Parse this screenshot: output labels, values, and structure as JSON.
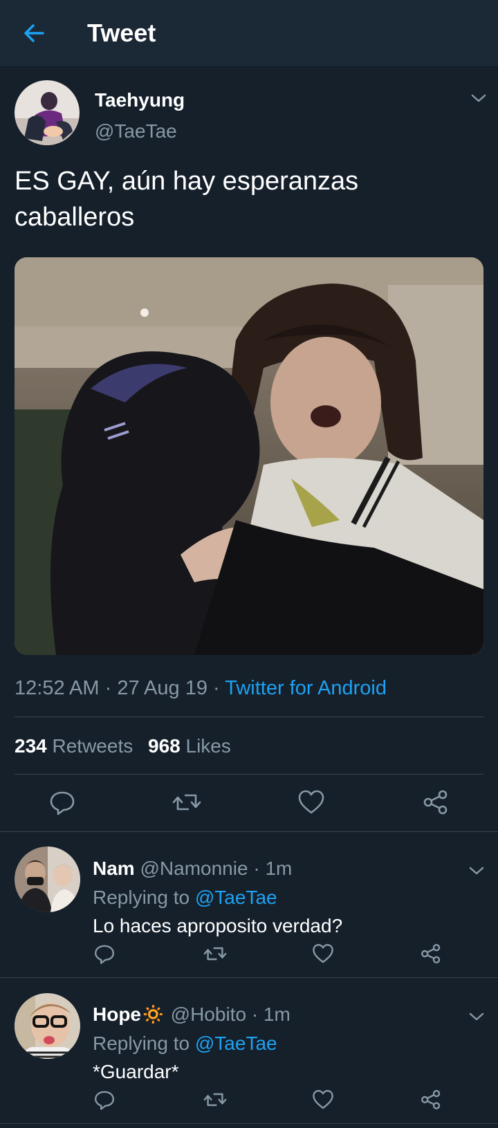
{
  "header": {
    "title": "Tweet",
    "back_icon": "arrow-left-icon",
    "accent": "#1da1f2"
  },
  "tweet": {
    "author_name": "Taehyung",
    "author_handle": "@TaeTae",
    "text": "ES GAY, aún hay esperanzas caballeros",
    "time": "12:52 AM",
    "sep": "·",
    "date": "27 Aug 19",
    "source": "Twitter for Android",
    "retweets_count": "234",
    "retweets_label": "Retweets",
    "likes_count": "968",
    "likes_label": "Likes"
  },
  "replies": [
    {
      "name": "Nam",
      "handle": "@Namonnie",
      "sep": "·",
      "time": "1m",
      "replying_label": "Replying to",
      "replying_to": "@TaeTae",
      "text": "Lo haces aproposito verdad?"
    },
    {
      "name": "Hope",
      "emoji": "🔅",
      "handle": "@Hobito",
      "sep": "·",
      "time": "1m",
      "replying_label": "Replying to",
      "replying_to": "@TaeTae",
      "text": "*Guardar*"
    }
  ],
  "colors": {
    "background": "#15202b",
    "header": "#1b2836",
    "muted": "#8899a6",
    "divider": "#38444d",
    "link": "#1da1f2"
  }
}
